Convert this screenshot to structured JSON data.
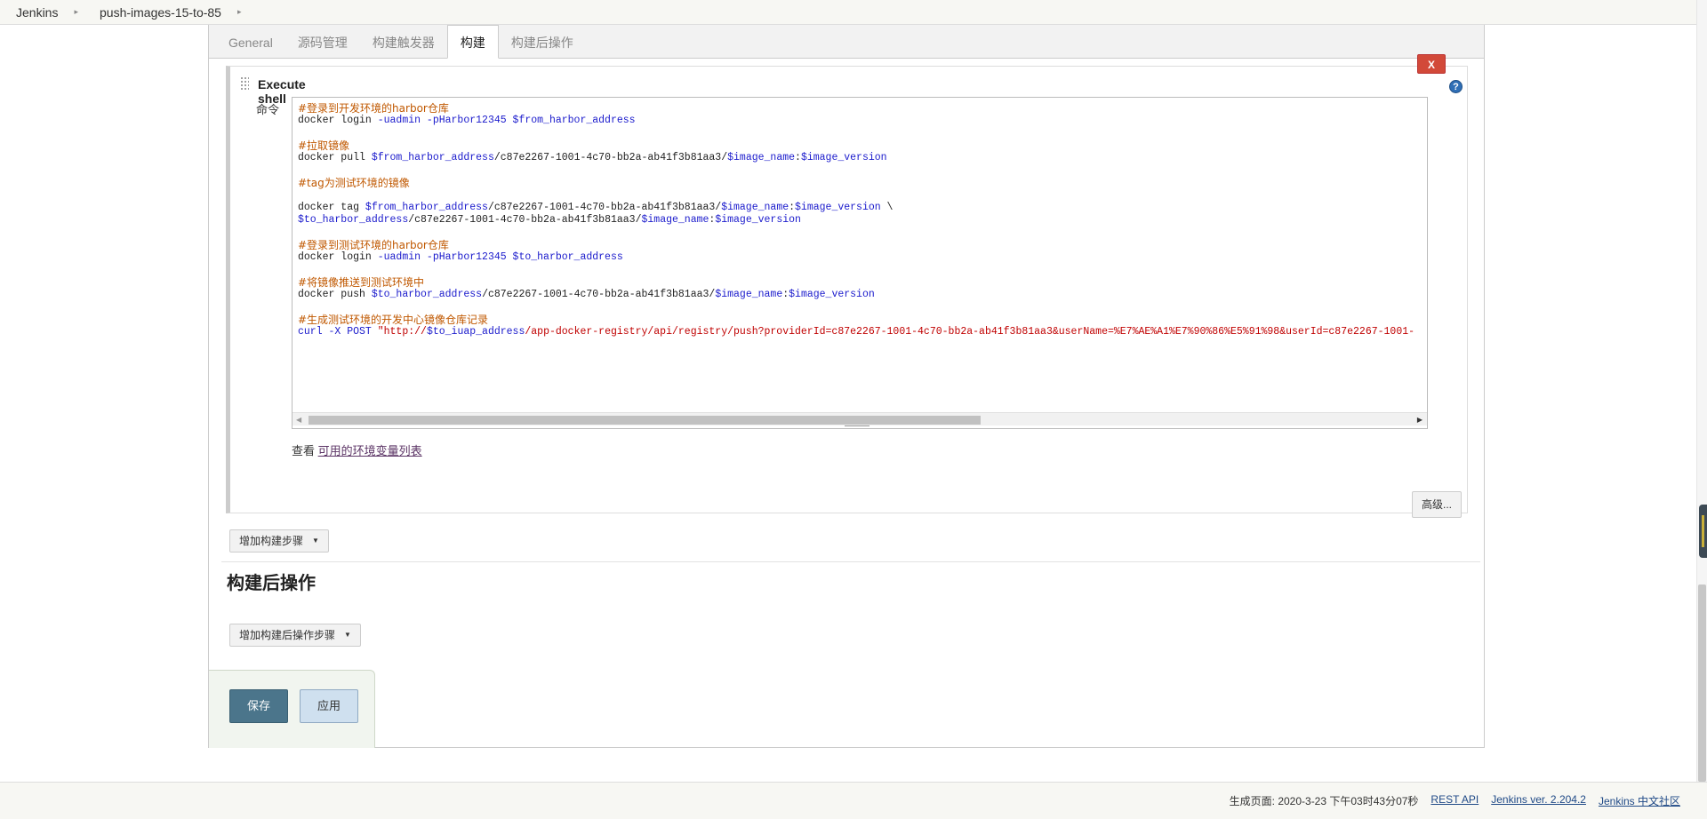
{
  "breadcrumb": [
    {
      "label": "Jenkins"
    },
    {
      "label": "push-images-15-to-85"
    }
  ],
  "tabs": [
    {
      "label": "General",
      "active": false
    },
    {
      "label": "源码管理",
      "active": false
    },
    {
      "label": "构建触发器",
      "active": false
    },
    {
      "label": "构建",
      "active": true
    },
    {
      "label": "构建后操作",
      "active": false
    }
  ],
  "build_step": {
    "title": "Execute shell",
    "delete_label": "X",
    "help_label": "?",
    "command_label": "命令",
    "command_lines": [
      {
        "type": "comment",
        "text": "#登录到开发环境的harbor仓库"
      },
      {
        "type": "code",
        "parts": [
          {
            "c": "plain",
            "t": "docker login "
          },
          {
            "c": "var",
            "t": "-uadmin -pHarbor12345 $from_harbor_address"
          }
        ]
      },
      {
        "type": "gap"
      },
      {
        "type": "comment",
        "text": "#拉取镜像"
      },
      {
        "type": "code",
        "parts": [
          {
            "c": "plain",
            "t": "docker pull "
          },
          {
            "c": "var",
            "t": "$from_harbor_address"
          },
          {
            "c": "plain",
            "t": "/c87e2267-1001-4c70-bb2a-ab41f3b81aa3/"
          },
          {
            "c": "var",
            "t": "$image_name"
          },
          {
            "c": "plain",
            "t": ":"
          },
          {
            "c": "var",
            "t": "$image_version"
          }
        ]
      },
      {
        "type": "gap"
      },
      {
        "type": "comment",
        "text": "#tag为测试环境的镜像"
      },
      {
        "type": "gap"
      },
      {
        "type": "code",
        "parts": [
          {
            "c": "plain",
            "t": "docker tag "
          },
          {
            "c": "var",
            "t": "$from_harbor_address"
          },
          {
            "c": "plain",
            "t": "/c87e2267-1001-4c70-bb2a-ab41f3b81aa3/"
          },
          {
            "c": "var",
            "t": "$image_name"
          },
          {
            "c": "plain",
            "t": ":"
          },
          {
            "c": "var",
            "t": "$image_version"
          },
          {
            "c": "plain",
            "t": " \\"
          }
        ]
      },
      {
        "type": "code",
        "parts": [
          {
            "c": "var",
            "t": "$to_harbor_address"
          },
          {
            "c": "plain",
            "t": "/c87e2267-1001-4c70-bb2a-ab41f3b81aa3/"
          },
          {
            "c": "var",
            "t": "$image_name"
          },
          {
            "c": "plain",
            "t": ":"
          },
          {
            "c": "var",
            "t": "$image_version"
          }
        ]
      },
      {
        "type": "gap"
      },
      {
        "type": "comment",
        "text": "#登录到测试环境的harbor仓库"
      },
      {
        "type": "code",
        "parts": [
          {
            "c": "plain",
            "t": "docker login "
          },
          {
            "c": "var",
            "t": "-uadmin -pHarbor12345 $to_harbor_address"
          }
        ]
      },
      {
        "type": "gap"
      },
      {
        "type": "comment",
        "text": "#将镜像推送到测试环境中"
      },
      {
        "type": "code",
        "parts": [
          {
            "c": "plain",
            "t": "docker push "
          },
          {
            "c": "var",
            "t": "$to_harbor_address"
          },
          {
            "c": "plain",
            "t": "/c87e2267-1001-4c70-bb2a-ab41f3b81aa3/"
          },
          {
            "c": "var",
            "t": "$image_name"
          },
          {
            "c": "plain",
            "t": ":"
          },
          {
            "c": "var",
            "t": "$image_version"
          }
        ]
      },
      {
        "type": "gap"
      },
      {
        "type": "comment",
        "text": "#生成测试环境的开发中心镜像仓库记录"
      },
      {
        "type": "code",
        "parts": [
          {
            "c": "var",
            "t": "curl -X POST "
          },
          {
            "c": "str",
            "t": "\"http://"
          },
          {
            "c": "var",
            "t": "$to_iuap_address"
          },
          {
            "c": "str",
            "t": "/app-docker-registry/api/registry/push?providerId=c87e2267-1001-4c70-bb2a-ab41f3b81aa3&userName=%E7%AE%A1%E7%90%86%E5%91%98&userId=c87e2267-1001-"
          }
        ]
      }
    ],
    "env_prefix": "查看 ",
    "env_link": "可用的环境变量列表",
    "advanced_label": "高级..."
  },
  "add_build_step_label": "增加构建步骤",
  "post_build": {
    "title": "构建后操作",
    "add_label": "增加构建后操作步骤"
  },
  "actions": {
    "save_label": "保存",
    "apply_label": "应用"
  },
  "footer": {
    "generated": "生成页面: 2020-3-23 下午03时43分07秒",
    "rest_api": "REST API",
    "version": "Jenkins ver. 2.204.2",
    "community": "Jenkins 中文社区"
  },
  "colors": {
    "comment": "#c05800",
    "variable": "#1a1acc",
    "string": "#c00000",
    "save_button": "#4b758b",
    "delete_button": "#d24939"
  }
}
